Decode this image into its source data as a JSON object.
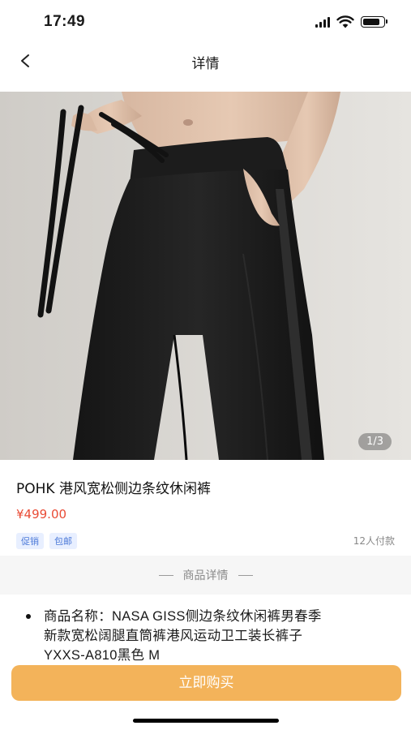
{
  "status_bar": {
    "time": "17:49",
    "signal_icon": "cellular-signal-icon",
    "wifi_icon": "wifi-icon",
    "battery_icon": "battery-icon",
    "battery_level": 0.85
  },
  "nav": {
    "back_icon": "chevron-left-icon",
    "title": "详情"
  },
  "product": {
    "image_counter": "1/3",
    "title": "POHK 港风宽松侧边条纹休闲裤",
    "price": "¥499.00",
    "tags": [
      "促销",
      "包邮"
    ],
    "paid_count": "12人付款"
  },
  "section": {
    "title": "商品详情"
  },
  "details": {
    "line1": "商品名称：NASA GISS侧边条纹休闲裤男春季",
    "line2": "新款宽松阔腿直筒裤港风运动卫工装长裤子",
    "line3": "YXXS-A810黑色 M"
  },
  "buy_button": {
    "label": "立即购买"
  },
  "colors": {
    "accent": "#f3b35a",
    "price": "#e94b35",
    "tag_text": "#4d7ad8",
    "tag_bg": "#e8efff"
  }
}
